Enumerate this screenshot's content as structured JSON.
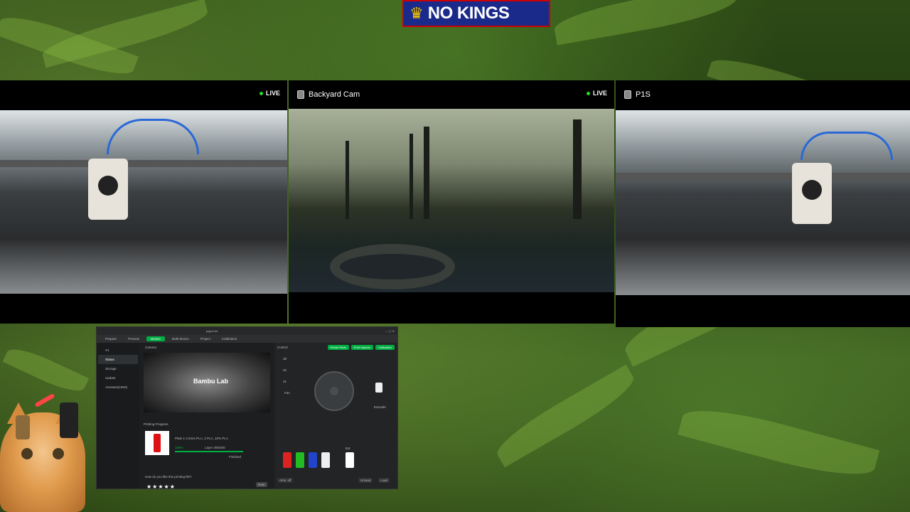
{
  "banner": {
    "text": "NO KINGS",
    "icon": "crown-icon",
    "bg": "#1a2a8a",
    "border": "#cc0000"
  },
  "cameras": [
    {
      "title": "",
      "live_label": "LIVE",
      "live": true
    },
    {
      "title": "Backyard Cam",
      "live_label": "LIVE",
      "live": true
    },
    {
      "title": "P1S",
      "live_label": "",
      "live": false
    }
  ],
  "app": {
    "window_title": "pqpcn.txt",
    "tabs": [
      "Prepare",
      "Preview",
      "Device",
      "Multi-device",
      "Project",
      "Calibration"
    ],
    "active_tab": "Device",
    "sidebar": {
      "printer": "X1",
      "items": [
        "Status",
        "Storage",
        "Update",
        "Assistant(HMS)"
      ],
      "selected": "Status"
    },
    "camera_section": "Camera",
    "camera_logo": "Bambu Lab",
    "control_section": "Control",
    "control_buttons": [
      "Printer Parts",
      "Print Options",
      "Calibration"
    ],
    "temps": [
      "38",
      "32",
      "31"
    ],
    "fan_label": "Fan",
    "progress_section": "Printing Progress",
    "print_info": "Plate 1 0.2mm PLA, 2 PLA, 10% PLA",
    "progress_percent": "100%",
    "progress_value": 1.0,
    "layer_label": "Layer 400/400",
    "finish_label": "Finished",
    "ams_buttons": [
      "Ams: off",
      "Unload",
      "Load"
    ],
    "ext_label": "Ext",
    "extruder_label": "Extruder",
    "rating_prompt": "How do you like this printing file?",
    "stars": "★★★★★",
    "rate_button": "Rate",
    "colors": {
      "accent": "#00ae42"
    }
  }
}
